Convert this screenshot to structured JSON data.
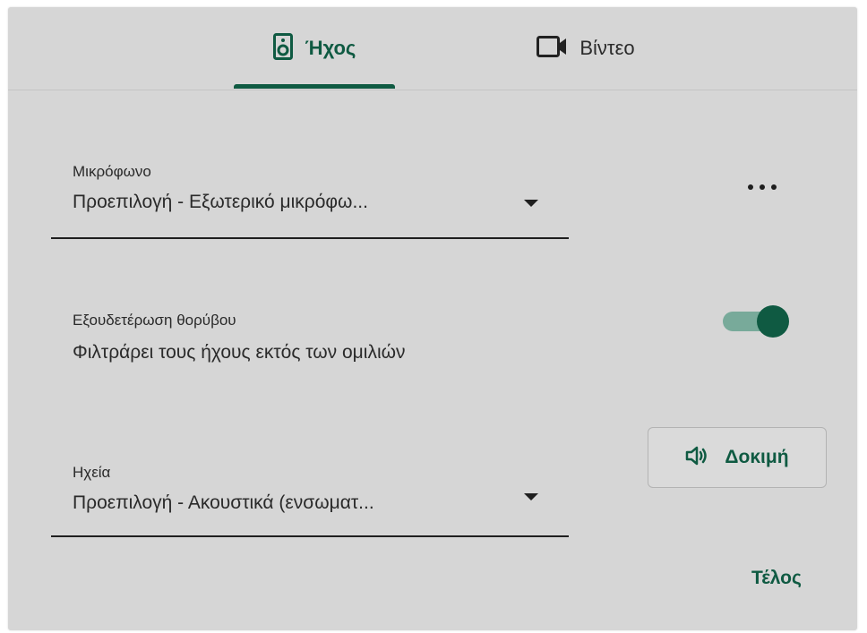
{
  "tabs": [
    {
      "label": "Ήχος",
      "icon": "speaker-icon",
      "selected": true
    },
    {
      "label": "Βίντεο",
      "icon": "video-camera-icon",
      "selected": false
    }
  ],
  "microphone": {
    "label": "Μικρόφωνο",
    "value": "Προεπιλογή - Εξωτερικό μικρόφω..."
  },
  "noise_cancellation": {
    "label": "Εξουδετέρωση θορύβου",
    "description": "Φιλτράρει τους ήχους εκτός των ομιλιών",
    "enabled": true
  },
  "speakers": {
    "label": "Ηχεία",
    "value": "Προεπιλογή - Ακουστικά (ενσωματ..."
  },
  "test_button": {
    "label": "Δοκιμή",
    "icon": "volume-icon"
  },
  "done_label": "Τέλος",
  "more_icon": "more-horizontal-icon",
  "colors": {
    "accent": "#0f5a42",
    "toggle_track": "#78aa9a",
    "dialog_background": "#d6d6d6"
  }
}
